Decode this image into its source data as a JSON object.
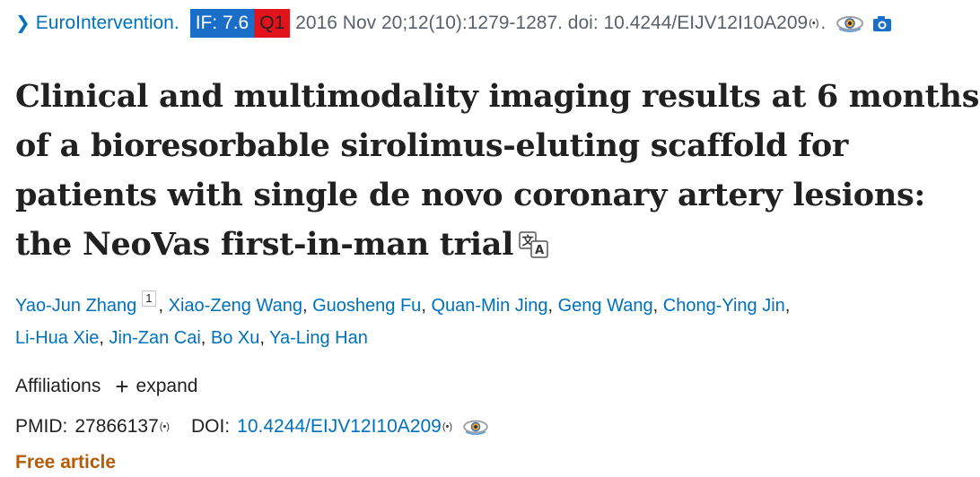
{
  "citation": {
    "journal_link": "EuroIntervention.",
    "impact_factor": "IF: 7.6",
    "quartile": "Q1",
    "reference": "2016 Nov 20;12(10):1279-1287. doi: 10.4244/EIJV12I10A209",
    "period": ".",
    "radar_glyph": "(•)"
  },
  "article": {
    "title": "Clinical and multimodality imaging results at 6 months of a bioresorbable sirolimus-eluting scaffold for patients with single de novo coronary artery lesions: the NeoVas first-in-man trial"
  },
  "authors": {
    "list": [
      "Yao-Jun Zhang",
      "Xiao-Zeng Wang",
      "Guosheng Fu",
      "Quan-Min Jing",
      "Geng Wang",
      "Chong-Ying Jin",
      "Li-Hua Xie",
      "Jin-Zan Cai",
      "Bo Xu",
      "Ya-Ling Han"
    ],
    "first_affiliation_marker": "1",
    "separator": ","
  },
  "affiliations": {
    "label": "Affiliations",
    "expand_symbol": "+",
    "expand_label": "expand"
  },
  "identifiers": {
    "pmid_label": "PMID:",
    "pmid_value": "27866137",
    "doi_label": "DOI:",
    "doi_value": "10.4244/EIJV12I10A209",
    "radar_glyph": "(•)"
  },
  "access": {
    "free_label": "Free article"
  },
  "icons": {
    "chevron": "chevron-right-icon",
    "eye": "eye-preview-icon",
    "camera": "camera-icon",
    "translate": "translate-icon"
  },
  "colors": {
    "link": "#0071bc",
    "if_badge": "#1a6ec7",
    "q_badge": "#e3131e",
    "free_article": "#b65b06",
    "text": "#212121"
  }
}
